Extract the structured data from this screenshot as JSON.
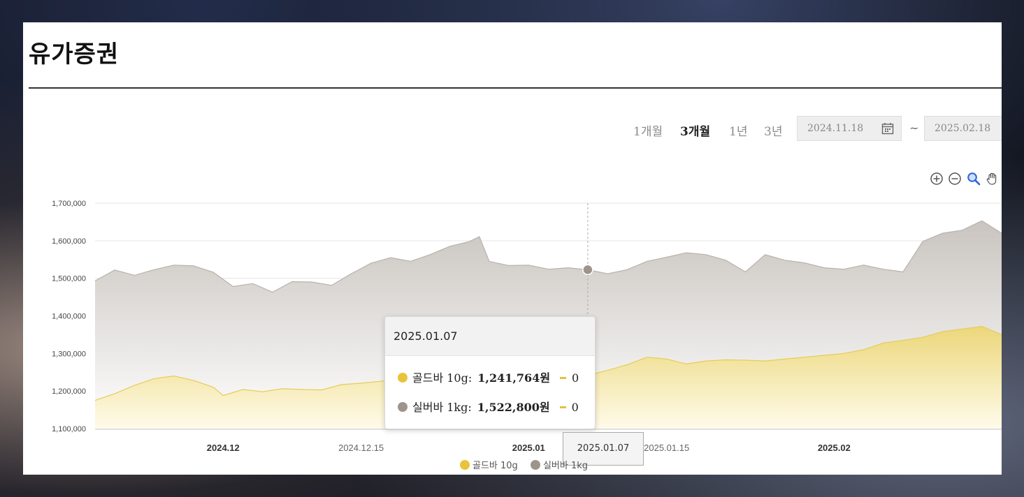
{
  "page": {
    "title": "유가증권"
  },
  "controls": {
    "periods": [
      {
        "label": "1개월",
        "active": false
      },
      {
        "label": "3개월",
        "active": true
      },
      {
        "label": "1년",
        "active": false
      },
      {
        "label": "3년",
        "active": false
      }
    ],
    "start_date": "2024.11.18",
    "separator": "~",
    "end_date": "2025.02.18",
    "tools": [
      "zoom-in-icon",
      "zoom-out-icon",
      "search-zoom-icon",
      "pan-hand-icon"
    ]
  },
  "colors": {
    "gold": "#e8c43a",
    "silver": "#9d958c",
    "gold_fill": "#efdc8a",
    "silver_fill": "#cfcbc6"
  },
  "tooltip": {
    "date": "2025.01.07",
    "rows": [
      {
        "series": "골드바 10g:",
        "value": "1,241,764원",
        "change": "0"
      },
      {
        "series": "실버바 1kg:",
        "value": "1,522,800원",
        "change": "0"
      }
    ]
  },
  "crosshair_label": "2025.01.07",
  "chart_data": {
    "type": "area",
    "ylim": [
      1100000,
      1700000
    ],
    "y_ticks": [
      "1,100,000",
      "1,200,000",
      "1,300,000",
      "1,400,000",
      "1,500,000",
      "1,600,000",
      "1,700,000"
    ],
    "x_ticks": [
      {
        "label": "2024.12",
        "bold": true
      },
      {
        "label": "2024.12.15",
        "bold": false
      },
      {
        "label": "2025.01",
        "bold": true
      },
      {
        "label": "2025.01.15",
        "bold": false
      },
      {
        "label": "2025.02",
        "bold": true
      }
    ],
    "x_tick_dates": [
      "2024-12-01",
      "2024-12-15",
      "2025-01-01",
      "2025-01-15",
      "2025-02-01"
    ],
    "x_range": [
      "2024-11-18",
      "2025-02-18"
    ],
    "series": [
      {
        "name": "실버바 1kg",
        "color": "#9d958c",
        "points": [
          [
            "2024-11-18",
            1493000
          ],
          [
            "2024-11-20",
            1522000
          ],
          [
            "2024-11-22",
            1508000
          ],
          [
            "2024-11-24",
            1523000
          ],
          [
            "2024-11-26",
            1535000
          ],
          [
            "2024-11-28",
            1533000
          ],
          [
            "2024-11-30",
            1516000
          ],
          [
            "2024-12-02",
            1478000
          ],
          [
            "2024-12-04",
            1486000
          ],
          [
            "2024-12-06",
            1463000
          ],
          [
            "2024-12-08",
            1491000
          ],
          [
            "2024-12-10",
            1490000
          ],
          [
            "2024-12-12",
            1481000
          ],
          [
            "2024-12-14",
            1512000
          ],
          [
            "2024-12-16",
            1540000
          ],
          [
            "2024-12-18",
            1555000
          ],
          [
            "2024-12-20",
            1545000
          ],
          [
            "2024-12-22",
            1563000
          ],
          [
            "2024-12-24",
            1585000
          ],
          [
            "2024-12-26",
            1598000
          ],
          [
            "2024-12-27",
            1611000
          ],
          [
            "2024-12-28",
            1545000
          ],
          [
            "2024-12-30",
            1534000
          ],
          [
            "2025-01-01",
            1535000
          ],
          [
            "2025-01-03",
            1524000
          ],
          [
            "2025-01-05",
            1528000
          ],
          [
            "2025-01-07",
            1522800
          ],
          [
            "2025-01-09",
            1512000
          ],
          [
            "2025-01-11",
            1523000
          ],
          [
            "2025-01-13",
            1545000
          ],
          [
            "2025-01-15",
            1556000
          ],
          [
            "2025-01-17",
            1568000
          ],
          [
            "2025-01-19",
            1563000
          ],
          [
            "2025-01-21",
            1548000
          ],
          [
            "2025-01-23",
            1517000
          ],
          [
            "2025-01-25",
            1563000
          ],
          [
            "2025-01-27",
            1548000
          ],
          [
            "2025-01-29",
            1541000
          ],
          [
            "2025-01-31",
            1528000
          ],
          [
            "2025-02-02",
            1524000
          ],
          [
            "2025-02-04",
            1535000
          ],
          [
            "2025-02-06",
            1524000
          ],
          [
            "2025-02-08",
            1517000
          ],
          [
            "2025-02-10",
            1598000
          ],
          [
            "2025-02-12",
            1620000
          ],
          [
            "2025-02-14",
            1628000
          ],
          [
            "2025-02-16",
            1653000
          ],
          [
            "2025-02-18",
            1620000
          ]
        ]
      },
      {
        "name": "골드바 10g",
        "color": "#e8c43a",
        "points": [
          [
            "2024-11-18",
            1175000
          ],
          [
            "2024-11-20",
            1193000
          ],
          [
            "2024-11-22",
            1215000
          ],
          [
            "2024-11-24",
            1233000
          ],
          [
            "2024-11-26",
            1240000
          ],
          [
            "2024-11-28",
            1228000
          ],
          [
            "2024-11-30",
            1210000
          ],
          [
            "2024-12-01",
            1188000
          ],
          [
            "2024-12-03",
            1204000
          ],
          [
            "2024-12-05",
            1198000
          ],
          [
            "2024-12-07",
            1206000
          ],
          [
            "2024-12-09",
            1204000
          ],
          [
            "2024-12-11",
            1203000
          ],
          [
            "2024-12-13",
            1217000
          ],
          [
            "2024-12-15",
            1221000
          ],
          [
            "2024-12-17",
            1226000
          ],
          [
            "2024-12-19",
            1235000
          ],
          [
            "2024-12-21",
            1243000
          ],
          [
            "2024-12-23",
            1255000
          ],
          [
            "2024-12-25",
            1262000
          ],
          [
            "2024-12-27",
            1243000
          ],
          [
            "2024-12-29",
            1239000
          ],
          [
            "2024-12-31",
            1241000
          ],
          [
            "2025-01-03",
            1242000
          ],
          [
            "2025-01-05",
            1240000
          ],
          [
            "2025-01-07",
            1241764
          ],
          [
            "2025-01-09",
            1255000
          ],
          [
            "2025-01-11",
            1270000
          ],
          [
            "2025-01-13",
            1290000
          ],
          [
            "2025-01-15",
            1285000
          ],
          [
            "2025-01-17",
            1272000
          ],
          [
            "2025-01-19",
            1280000
          ],
          [
            "2025-01-21",
            1283000
          ],
          [
            "2025-01-23",
            1282000
          ],
          [
            "2025-01-25",
            1280000
          ],
          [
            "2025-01-27",
            1285000
          ],
          [
            "2025-01-29",
            1290000
          ],
          [
            "2025-01-31",
            1295000
          ],
          [
            "2025-02-02",
            1300000
          ],
          [
            "2025-02-04",
            1310000
          ],
          [
            "2025-02-06",
            1328000
          ],
          [
            "2025-02-08",
            1335000
          ],
          [
            "2025-02-10",
            1343000
          ],
          [
            "2025-02-12",
            1358000
          ],
          [
            "2025-02-14",
            1365000
          ],
          [
            "2025-02-16",
            1372000
          ],
          [
            "2025-02-18",
            1350000
          ]
        ]
      }
    ],
    "highlight_date": "2025-01-07",
    "legend": [
      "골드바 10g",
      "실버바 1kg"
    ]
  }
}
